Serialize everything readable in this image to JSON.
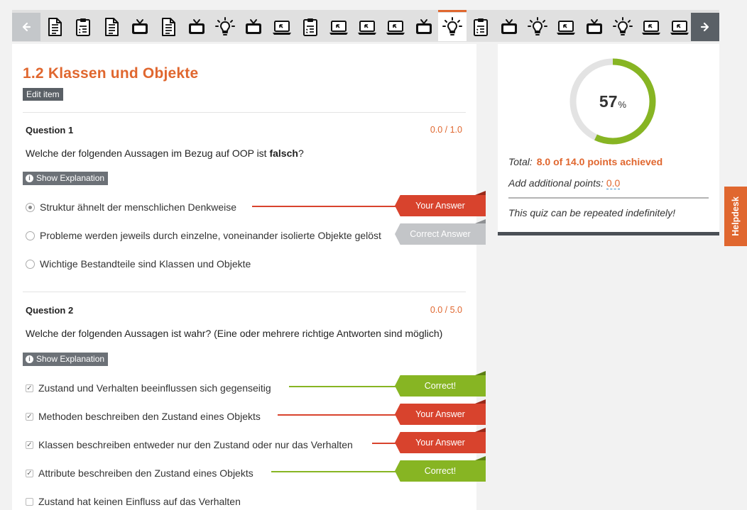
{
  "nav": {
    "prev_icon": "arrow-left-icon",
    "next_icon": "arrow-right-icon",
    "items": [
      {
        "icon": "document-icon",
        "active": false
      },
      {
        "icon": "clipboard-icon",
        "active": false
      },
      {
        "icon": "document-icon",
        "active": false
      },
      {
        "icon": "tv-icon",
        "active": false
      },
      {
        "icon": "document-icon",
        "active": false
      },
      {
        "icon": "tv-icon",
        "active": false
      },
      {
        "icon": "lightbulb-icon",
        "active": false
      },
      {
        "icon": "tv-icon",
        "active": false
      },
      {
        "icon": "laptop-icon",
        "active": false
      },
      {
        "icon": "clipboard-icon",
        "active": false
      },
      {
        "icon": "laptop-icon",
        "active": false
      },
      {
        "icon": "laptop-icon",
        "active": false
      },
      {
        "icon": "laptop-icon",
        "active": false
      },
      {
        "icon": "tv-icon",
        "active": false
      },
      {
        "icon": "lightbulb-icon",
        "active": true
      },
      {
        "icon": "clipboard-icon",
        "active": false
      },
      {
        "icon": "tv-icon",
        "active": false
      },
      {
        "icon": "lightbulb-icon",
        "active": false
      },
      {
        "icon": "laptop-icon",
        "active": false
      },
      {
        "icon": "tv-icon",
        "active": false
      },
      {
        "icon": "lightbulb-icon",
        "active": false
      },
      {
        "icon": "laptop-icon",
        "active": false
      },
      {
        "icon": "laptop-icon",
        "active": false
      }
    ]
  },
  "page": {
    "title": "1.2 Klassen und Objekte",
    "edit_label": "Edit item"
  },
  "questions": [
    {
      "label": "Question 1",
      "score": "0.0 / 1.0",
      "text_before": "Welche der folgenden Aussagen im Bezug auf OOP ist ",
      "text_bold": "falsch",
      "text_after": "?",
      "explanation_label": "Show Explanation",
      "answers": [
        {
          "text": "Struktur ähnelt der menschlichen Denkweise",
          "selected": true,
          "feedback": "Your Answer"
        },
        {
          "text": "Probleme werden jeweils durch einzelne, voneinander isolierte Objekte gelöst",
          "selected": false,
          "feedback": "Correct Answer"
        },
        {
          "text": "Wichtige Bestandteile sind Klassen und Objekte",
          "selected": false,
          "feedback": ""
        }
      ]
    },
    {
      "label": "Question 2",
      "score": "0.0 / 5.0",
      "text": "Welche der folgenden Aussagen ist wahr? (Eine oder mehrere richtige Antworten sind möglich)",
      "explanation_label": "Show Explanation",
      "answers": [
        {
          "text": "Zustand und Verhalten beeinflussen sich gegenseitig",
          "selected": true,
          "feedback": "Correct!"
        },
        {
          "text": "Methoden beschreiben den Zustand eines Objekts",
          "selected": true,
          "feedback": "Your Answer"
        },
        {
          "text": "Klassen beschreiben entweder nur den Zustand oder nur das Verhalten",
          "selected": true,
          "feedback": "Your Answer"
        },
        {
          "text": "Attribute beschreiben den Zustand eines Objekts",
          "selected": true,
          "feedback": "Correct!"
        },
        {
          "text": "Zustand hat keinen Einfluss auf das Verhalten",
          "selected": false,
          "feedback": ""
        }
      ]
    }
  ],
  "summary": {
    "percent": "57",
    "percent_sign": "%",
    "percent_value": 57,
    "total_label": "Total:",
    "total_value": "8.0 of 14.0 points achieved",
    "additional_label": "Add additional points:",
    "additional_value": "0.0",
    "repeat_note": "This quiz can be repeated indefinitely!"
  },
  "helpdesk_label": "Helpdesk",
  "colors": {
    "accent": "#e0672f",
    "wrong": "#d8432d",
    "correct": "#87b523",
    "correct_answer": "#c3c5c8",
    "donut_track": "#e3e3e3",
    "dark": "#5a6066"
  }
}
